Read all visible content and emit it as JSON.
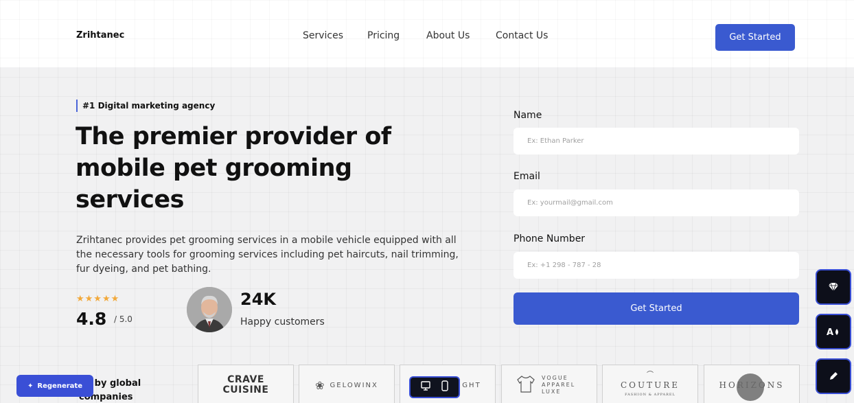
{
  "header": {
    "logo": "Zrihtanec",
    "nav": [
      "Services",
      "Pricing",
      "About Us",
      "Contact Us"
    ],
    "cta": "Get Started"
  },
  "hero": {
    "tag": "#1 Digital marketing agency",
    "headline": "The premier provider of mobile pet grooming services",
    "description": "Zrihtanec provides pet grooming services in a mobile vehicle equipped with all the necessary tools for grooming services including pet haircuts, nail trimming, fur dyeing, and pet bathing.",
    "stars": "★★★★★",
    "rating": "4.8",
    "rating_scale": "/ 5.0",
    "customers_count": "24K",
    "customers_label": "Happy customers"
  },
  "form": {
    "name_label": "Name",
    "name_placeholder": "Ex: Ethan Parker",
    "email_label": "Email",
    "email_placeholder": "Ex: yourmail@gmail.com",
    "phone_label": "Phone Number",
    "phone_placeholder": "Ex: +1 298 - 787 - 28",
    "submit": "Get Started"
  },
  "trusted": {
    "label": "ed by global companies",
    "brands": [
      {
        "name": "CRAVE CUISINE"
      },
      {
        "name": "GELOWINX"
      },
      {
        "name": "GHT"
      },
      {
        "name": "VOGUE APPAREL LUXE"
      },
      {
        "name": "COUTURE",
        "sub": "FASHION & APPAREL"
      },
      {
        "name": "HORIZONS"
      }
    ]
  },
  "widgets": {
    "regenerate": "Regenerate"
  },
  "colors": {
    "accent": "#3a5ad0",
    "star": "#f2a93b",
    "widget_dark": "#0d0f1a"
  }
}
